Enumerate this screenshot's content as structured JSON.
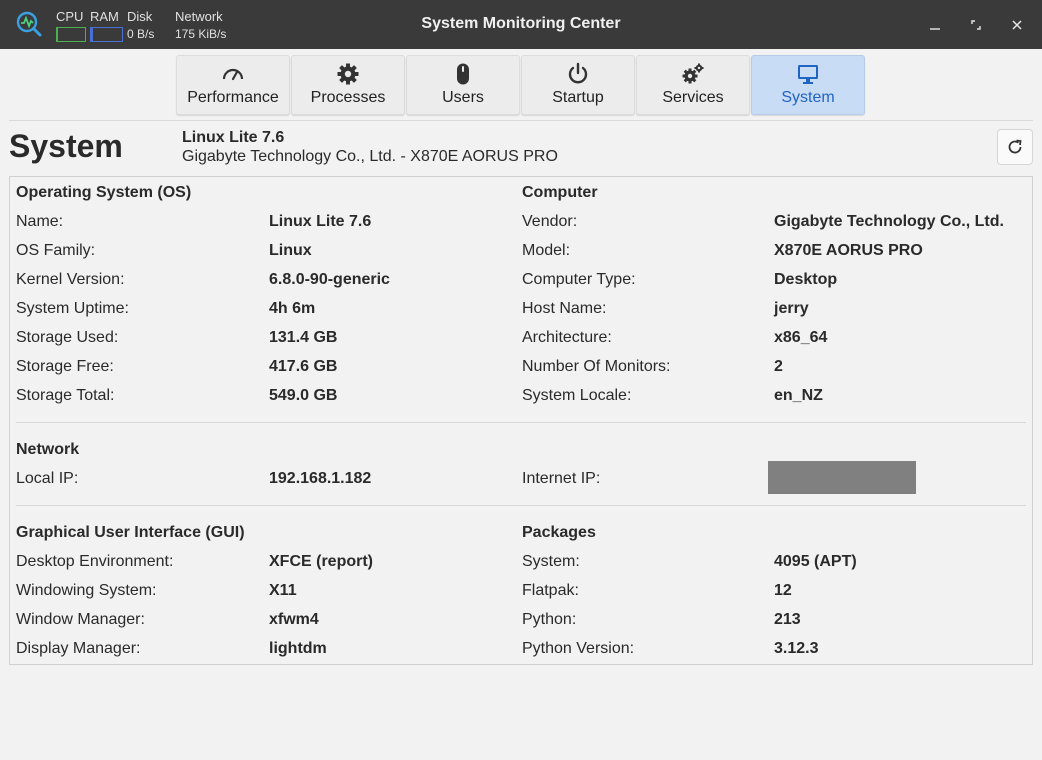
{
  "titlebar": {
    "title": "System Monitoring Center",
    "monitors": {
      "cpu_label": "CPU",
      "ram_label": "RAM",
      "disk_label": "Disk",
      "network_label": "Network",
      "disk_value": "0 B/s",
      "network_value": "175 KiB/s"
    },
    "cpu_bar_fraction": 0.03,
    "ram_bar_fraction": 0.08,
    "colors": {
      "cpu": "#4caf50",
      "ram": "#4a6fd4"
    }
  },
  "tabs": [
    {
      "label": "Performance",
      "icon": "speedometer-icon"
    },
    {
      "label": "Processes",
      "icon": "gear-icon"
    },
    {
      "label": "Users",
      "icon": "mouse-icon"
    },
    {
      "label": "Startup",
      "icon": "power-icon"
    },
    {
      "label": "Services",
      "icon": "gears-icon"
    },
    {
      "label": "System",
      "icon": "monitor-icon",
      "active": true
    }
  ],
  "header": {
    "title": "System",
    "os": "Linux Lite 7.6",
    "hardware": "Gigabyte Technology Co., Ltd. - X870E AORUS PRO"
  },
  "os_section": {
    "heading": "Operating System (OS)",
    "rows": [
      {
        "label": "Name:",
        "value": "Linux Lite 7.6"
      },
      {
        "label": "OS Family:",
        "value": "Linux"
      },
      {
        "label": "Kernel Version:",
        "value": "6.8.0-90-generic"
      },
      {
        "label": "System Uptime:",
        "value": "4h 6m"
      },
      {
        "label": "Storage Used:",
        "value": "131.4 GB"
      },
      {
        "label": "Storage Free:",
        "value": "417.6 GB"
      },
      {
        "label": "Storage Total:",
        "value": "549.0 GB"
      }
    ]
  },
  "computer_section": {
    "heading": "Computer",
    "rows": [
      {
        "label": "Vendor:",
        "value": "Gigabyte Technology Co., Ltd."
      },
      {
        "label": "Model:",
        "value": "X870E AORUS PRO"
      },
      {
        "label": "Computer Type:",
        "value": "Desktop"
      },
      {
        "label": "Host Name:",
        "value": "jerry"
      },
      {
        "label": "Architecture:",
        "value": "x86_64"
      },
      {
        "label": "Number Of Monitors:",
        "value": "2"
      },
      {
        "label": "System Locale:",
        "value": "en_NZ"
      }
    ]
  },
  "network_section": {
    "heading": "Network",
    "local_ip_label": "Local IP:",
    "local_ip_value": "192.168.1.182",
    "internet_ip_label": "Internet IP:"
  },
  "gui_section": {
    "heading": "Graphical User Interface (GUI)",
    "rows": [
      {
        "label": "Desktop Environment:",
        "value": "XFCE (report)"
      },
      {
        "label": "Windowing System:",
        "value": "X11"
      },
      {
        "label": "Window Manager:",
        "value": "xfwm4"
      },
      {
        "label": "Display Manager:",
        "value": "lightdm"
      }
    ]
  },
  "packages_section": {
    "heading": "Packages",
    "rows": [
      {
        "label": "System:",
        "value": "4095 (APT)"
      },
      {
        "label": "Flatpak:",
        "value": "12"
      },
      {
        "label": "Python:",
        "value": "213"
      },
      {
        "label": "Python Version:",
        "value": "3.12.3"
      }
    ]
  }
}
